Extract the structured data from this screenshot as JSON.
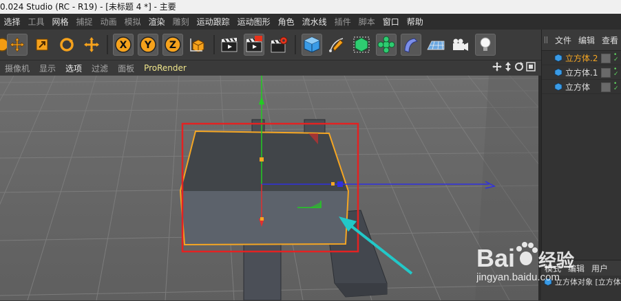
{
  "window": {
    "title": "0.024 Studio (RC - R19) - [未标题 4 *] - 主要"
  },
  "menubar": {
    "items": [
      {
        "label": "选择",
        "active": true
      },
      {
        "label": "工具",
        "active": false
      },
      {
        "label": "网格",
        "active": true
      },
      {
        "label": "捕捉",
        "active": false
      },
      {
        "label": "动画",
        "active": false
      },
      {
        "label": "模拟",
        "active": false
      },
      {
        "label": "渲染",
        "active": true
      },
      {
        "label": "雕刻",
        "active": false
      },
      {
        "label": "运动跟踪",
        "active": true
      },
      {
        "label": "运动图形",
        "active": true
      },
      {
        "label": "角色",
        "active": true
      },
      {
        "label": "流水线",
        "active": true
      },
      {
        "label": "插件",
        "active": false
      },
      {
        "label": "脚本",
        "active": false
      },
      {
        "label": "窗口",
        "active": true
      },
      {
        "label": "帮助",
        "active": true
      }
    ]
  },
  "toolbar": {
    "axis_x": "X",
    "axis_y": "Y",
    "axis_z": "Z"
  },
  "viewport_menu": {
    "items": [
      {
        "label": "摄像机",
        "class": ""
      },
      {
        "label": "显示",
        "class": ""
      },
      {
        "label": "选项",
        "class": "hl"
      },
      {
        "label": "过滤",
        "class": ""
      },
      {
        "label": "面板",
        "class": ""
      },
      {
        "label": "ProRender",
        "class": "pr"
      }
    ]
  },
  "object_manager": {
    "tabs": [
      "文件",
      "编辑",
      "查看"
    ],
    "objects": [
      {
        "name": "立方体.2",
        "selected": true
      },
      {
        "name": "立方体.1",
        "selected": false
      },
      {
        "name": "立方体",
        "selected": false
      }
    ]
  },
  "attributes": {
    "tabs": [
      "模式",
      "编辑",
      "用户"
    ],
    "object_label": "立方体对象 [立方体"
  },
  "watermark": {
    "brand": "Bai",
    "brand2": "du",
    "product": "经验",
    "url": "jingyan.baidu.com"
  },
  "colors": {
    "selection_highlight": "#f5a623",
    "annotation_box": "#e32222",
    "annotation_arrow": "#22c8c8",
    "axis_y": "#22cc22",
    "axis_x": "#e03030",
    "axis_z": "#3030e0"
  }
}
